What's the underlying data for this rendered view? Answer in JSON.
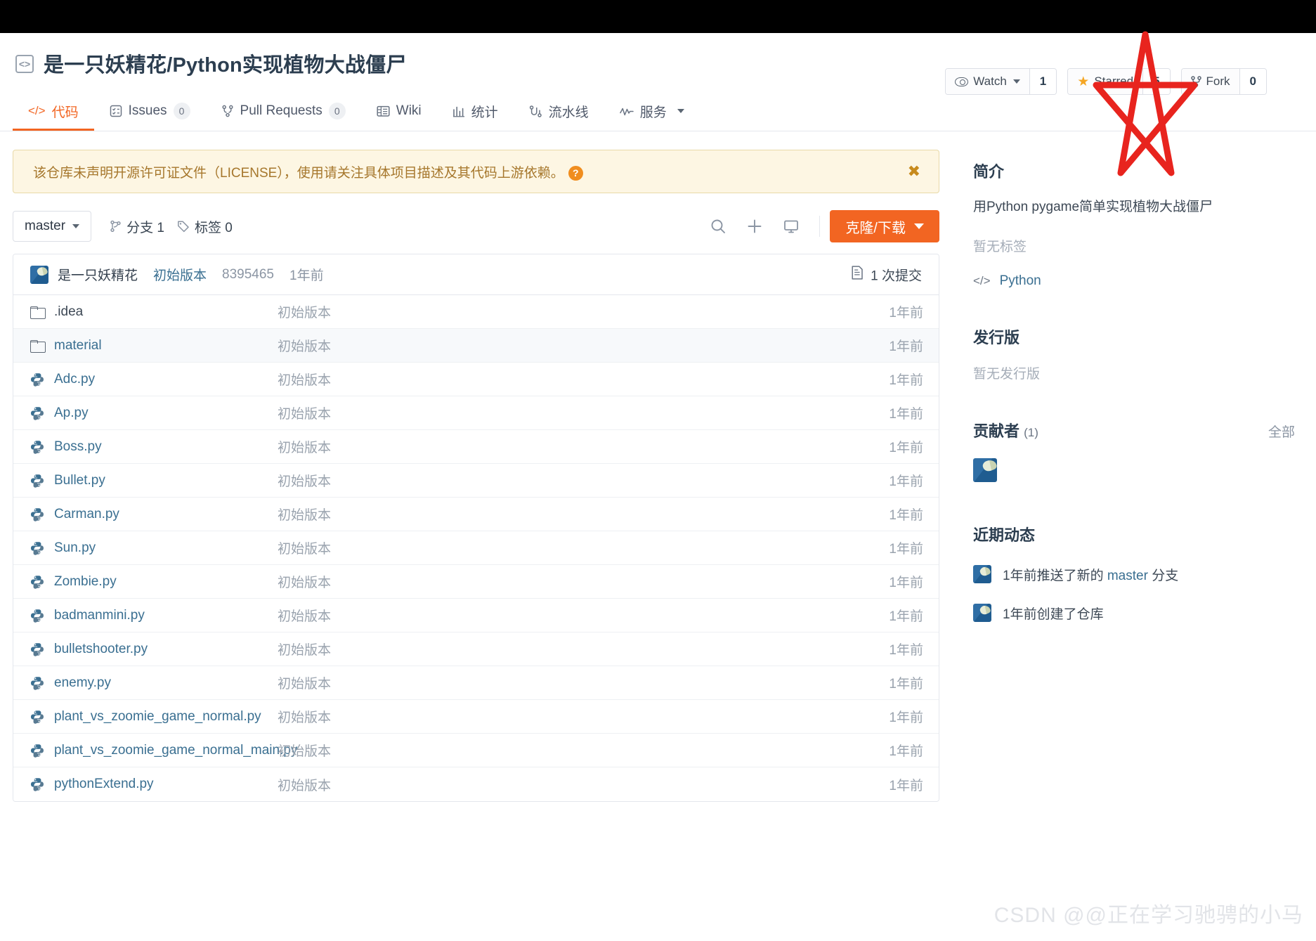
{
  "header": {
    "repo_icon": "code-repo-icon",
    "title": "是一只妖精花/Python实现植物大战僵尸",
    "actions": {
      "watch_label": "Watch",
      "watch_count": "1",
      "star_label": "Starred",
      "star_count": "5",
      "fork_label": "Fork",
      "fork_count": "0"
    }
  },
  "tabs": [
    {
      "label": "代码",
      "icon": "code-icon",
      "count": null,
      "active": true
    },
    {
      "label": "Issues",
      "icon": "issue-icon",
      "count": "0",
      "active": false
    },
    {
      "label": "Pull Requests",
      "icon": "pull-request-icon",
      "count": "0",
      "active": false
    },
    {
      "label": "Wiki",
      "icon": "book-icon",
      "count": null,
      "active": false
    },
    {
      "label": "统计",
      "icon": "chart-icon",
      "count": null,
      "active": false
    },
    {
      "label": "流水线",
      "icon": "pipeline-icon",
      "count": null,
      "active": false
    },
    {
      "label": "服务",
      "icon": "activity-icon",
      "count": null,
      "active": false
    }
  ],
  "banner": {
    "text": "该仓库未声明开源许可证文件（LICENSE），使用请关注具体项目描述及其代码上游依赖。",
    "help_icon": "question-mark-icon",
    "close_icon": "close-icon"
  },
  "toolbar": {
    "branch": "master",
    "branches_label": "分支 1",
    "tags_label": "标签 0",
    "search_icon": "search-icon",
    "add_icon": "plus-icon",
    "ide_icon": "monitor-icon",
    "clone_label": "克隆/下载"
  },
  "commit_bar": {
    "author": "是一只妖精花",
    "message": "初始版本",
    "sha": "8395465",
    "time": "1年前",
    "commits_label": "1 次提交",
    "commits_icon": "history-icon"
  },
  "files": [
    {
      "name": ".idea",
      "type": "folder",
      "message": "初始版本",
      "time": "1年前",
      "highlight": false
    },
    {
      "name": "material",
      "type": "folder",
      "message": "初始版本",
      "time": "1年前",
      "highlight": true
    },
    {
      "name": "Adc.py",
      "type": "python",
      "message": "初始版本",
      "time": "1年前",
      "highlight": false
    },
    {
      "name": "Ap.py",
      "type": "python",
      "message": "初始版本",
      "time": "1年前",
      "highlight": false
    },
    {
      "name": "Boss.py",
      "type": "python",
      "message": "初始版本",
      "time": "1年前",
      "highlight": false
    },
    {
      "name": "Bullet.py",
      "type": "python",
      "message": "初始版本",
      "time": "1年前",
      "highlight": false
    },
    {
      "name": "Carman.py",
      "type": "python",
      "message": "初始版本",
      "time": "1年前",
      "highlight": false
    },
    {
      "name": "Sun.py",
      "type": "python",
      "message": "初始版本",
      "time": "1年前",
      "highlight": false
    },
    {
      "name": "Zombie.py",
      "type": "python",
      "message": "初始版本",
      "time": "1年前",
      "highlight": false
    },
    {
      "name": "badmanmini.py",
      "type": "python",
      "message": "初始版本",
      "time": "1年前",
      "highlight": false
    },
    {
      "name": "bulletshooter.py",
      "type": "python",
      "message": "初始版本",
      "time": "1年前",
      "highlight": false
    },
    {
      "name": "enemy.py",
      "type": "python",
      "message": "初始版本",
      "time": "1年前",
      "highlight": false
    },
    {
      "name": "plant_vs_zoomie_game_normal.py",
      "type": "python",
      "message": "初始版本",
      "time": "1年前",
      "highlight": false
    },
    {
      "name": "plant_vs_zoomie_game_normal_main.py",
      "type": "python",
      "message": "初始版本",
      "time": "1年前",
      "highlight": false
    },
    {
      "name": "pythonExtend.py",
      "type": "python",
      "message": "初始版本",
      "time": "1年前",
      "highlight": false
    }
  ],
  "sidebar": {
    "about_title": "简介",
    "about_desc": "用Python pygame简单实现植物大战僵尸",
    "no_topics": "暂无标签",
    "language": "Python",
    "language_icon": "code-icon",
    "releases_title": "发行版",
    "no_releases": "暂无发行版",
    "contributors_title": "贡献者",
    "contributors_count": "(1)",
    "contributors_all": "全部",
    "activity_title": "近期动态",
    "activity": [
      {
        "prefix": "1年前推送了新的 ",
        "link": "master",
        "suffix": " 分支"
      },
      {
        "prefix": "1年前创建了仓库",
        "link": "",
        "suffix": ""
      }
    ]
  },
  "watermark": "CSDN @@正在学习驰骋的小马",
  "colors": {
    "accent": "#f26522",
    "link": "#3a6f91",
    "banner_bg": "#fdf6e3",
    "banner_border": "#e8d9a8",
    "banner_text": "#a6772c",
    "star": "#f5a623",
    "annotation": "#e8241e"
  }
}
